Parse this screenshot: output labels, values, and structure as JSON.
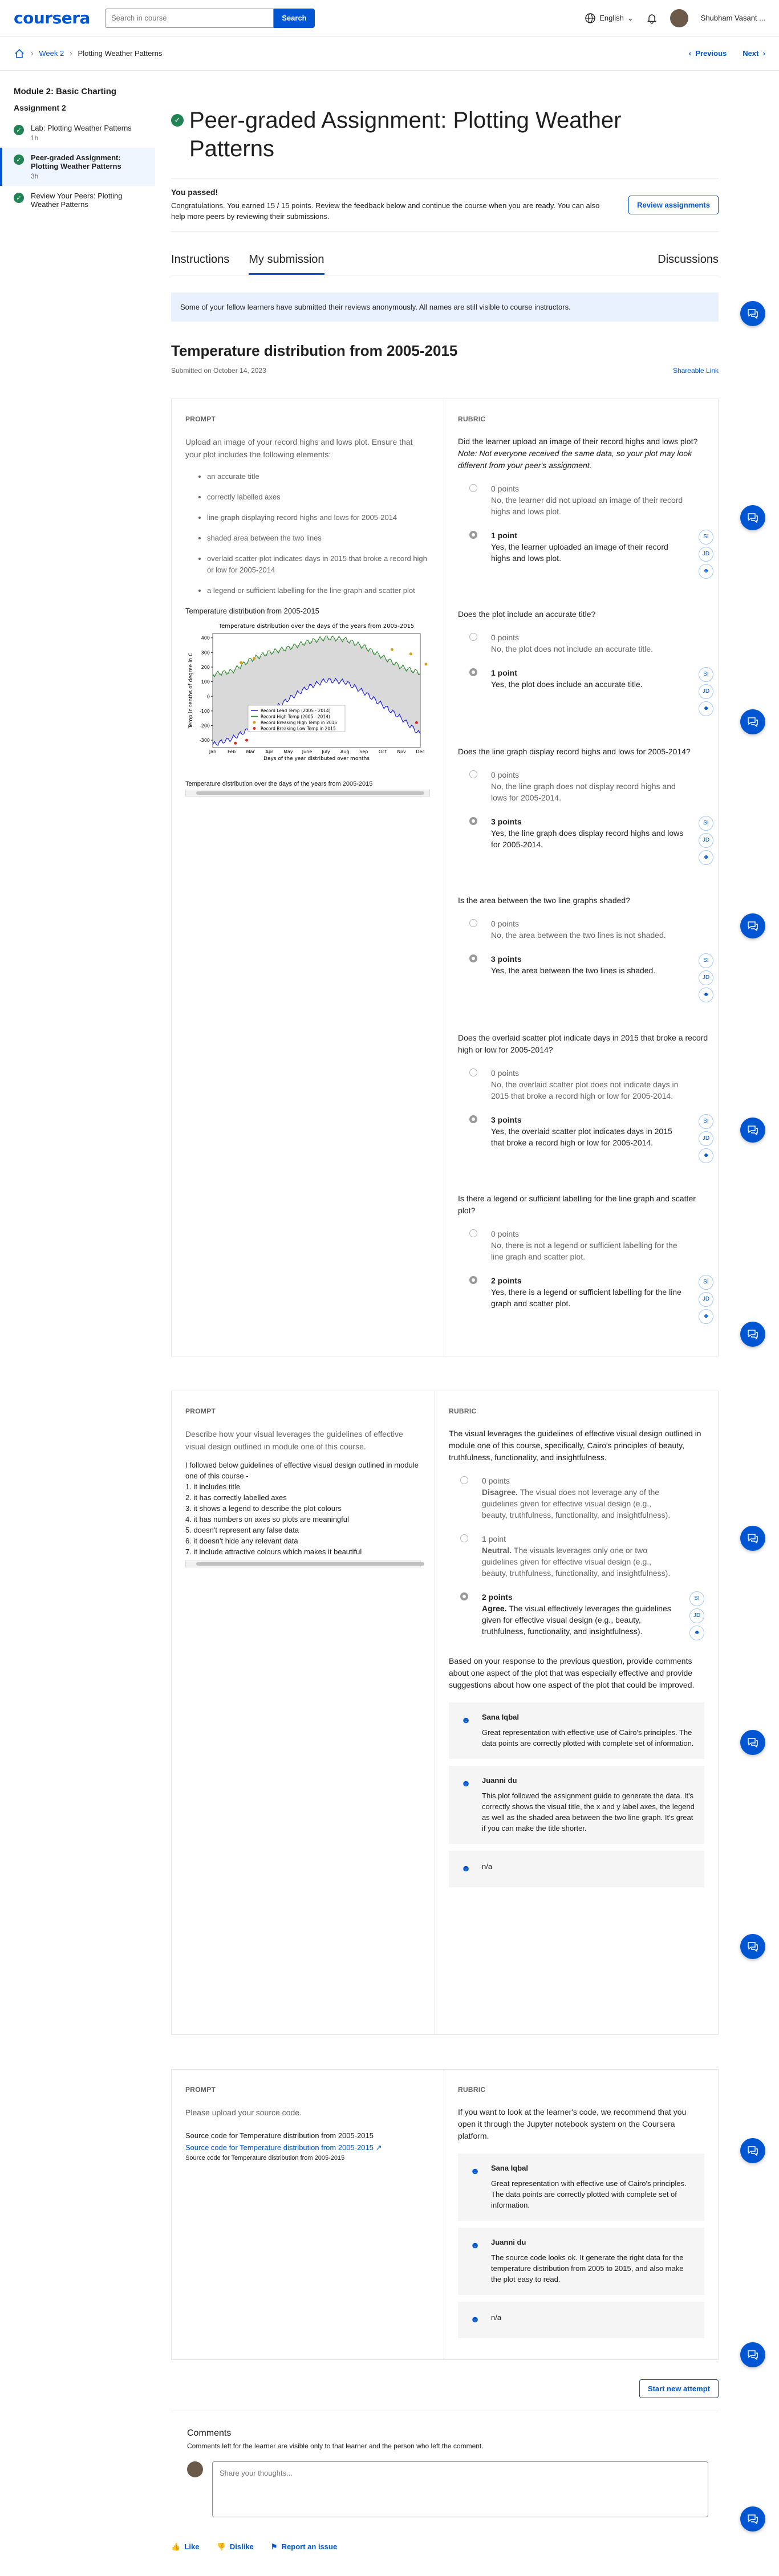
{
  "header": {
    "logo": "coursera",
    "search_placeholder": "Search in course",
    "search_button": "Search",
    "language": "English",
    "user_name": "Shubham Vasant ..."
  },
  "breadcrumb": {
    "week": "Week 2",
    "page": "Plotting Weather Patterns"
  },
  "nav": {
    "previous": "Previous",
    "next": "Next"
  },
  "sidebar": {
    "module": "Module 2: Basic Charting",
    "assignment": "Assignment 2",
    "items": [
      {
        "title": "Lab: Plotting Weather Patterns",
        "sub": "1h"
      },
      {
        "title": "Peer-graded Assignment: Plotting Weather Patterns",
        "sub": "3h"
      },
      {
        "title": "Review Your Peers: Plotting Weather Patterns",
        "sub": ""
      }
    ]
  },
  "main": {
    "title": "Peer-graded Assignment: Plotting Weather Patterns",
    "passed_title": "You passed!",
    "passed_text": "Congratulations. You earned 15 / 15 points. Review the feedback below and continue the course when you are ready. You can also help more peers by reviewing their submissions.",
    "review_button": "Review assignments",
    "tabs": [
      "Instructions",
      "My submission",
      "Discussions"
    ],
    "notice": "Some of your fellow learners have submitted their reviews anonymously. All names are still visible to course instructors.",
    "submission_title": "Temperature distribution from 2005-2015",
    "submitted_on": "Submitted on October 14, 2023",
    "shareable": "Shareable Link"
  },
  "labels": {
    "prompt": "PROMPT",
    "rubric": "RUBRIC"
  },
  "section1": {
    "prompt": "Upload an image of your record highs and lows plot. Ensure that your plot includes the following elements:",
    "bullets": [
      "an accurate title",
      "correctly labelled axes",
      "line graph displaying record highs and lows for 2005-2014",
      "shaded area between the two lines",
      "overlaid scatter plot indicates days in 2015 that broke a record high or low for 2005-2014",
      "a legend or sufficient labelling for the line graph and scatter plot"
    ],
    "response_title": "Temperature distribution from 2005-2015",
    "image_caption": "Temperature distribution over the days of the years from 2005-2015",
    "questions": [
      {
        "q": "Did the learner upload an image of their record highs and lows plot?",
        "note": "Note: Not everyone received the same data, so your plot may look different from your peer's assignment.",
        "opts": [
          {
            "pts": "0 points",
            "text": "No, the learner did not upload an image of their record highs and lows plot."
          },
          {
            "pts": "1 point",
            "text": "Yes, the learner uploaded an image of their record highs and lows plot."
          }
        ]
      },
      {
        "q": "Does the plot include an accurate title?",
        "opts": [
          {
            "pts": "0 points",
            "text": "No, the plot does not include an accurate title."
          },
          {
            "pts": "1 point",
            "text": "Yes, the plot does include an accurate title."
          }
        ]
      },
      {
        "q": "Does the line graph display record highs and lows for 2005-2014?",
        "opts": [
          {
            "pts": "0 points",
            "text": "No, the line graph does not display record highs and lows for 2005-2014."
          },
          {
            "pts": "3 points",
            "text": "Yes, the line graph does display record highs and lows for 2005-2014."
          }
        ]
      },
      {
        "q": "Is the area between the two line graphs shaded?",
        "opts": [
          {
            "pts": "0 points",
            "text": "No, the area between the two lines is not shaded."
          },
          {
            "pts": "3 points",
            "text": "Yes, the area between the two lines is shaded."
          }
        ]
      },
      {
        "q": "Does the overlaid scatter plot indicate days in 2015 that broke a record high or low for 2005-2014?",
        "opts": [
          {
            "pts": "0 points",
            "text": "No, the overlaid scatter plot does not indicate days in 2015 that broke a record high or low for 2005-2014."
          },
          {
            "pts": "3 points",
            "text": "Yes, the overlaid scatter plot indicates days in 2015 that broke a record high or low for 2005-2014."
          }
        ]
      },
      {
        "q": "Is there a legend or sufficient labelling for the line graph and scatter plot?",
        "opts": [
          {
            "pts": "0 points",
            "text": "No, there is not a legend or sufficient labelling for the line graph and scatter plot."
          },
          {
            "pts": "2 points",
            "text": "Yes, there is a legend or sufficient labelling for the line graph and scatter plot."
          }
        ]
      }
    ],
    "peer_initials": [
      "SI",
      "JD"
    ]
  },
  "chart_data": {
    "type": "line",
    "title": "Temperature distribution over the days of the years from 2005-2015",
    "xlabel": "Days of the year distributed over months",
    "ylabel": "Temp in tenths of degree in C",
    "categories": [
      "Jan",
      "Feb",
      "Mar",
      "Apr",
      "May",
      "June",
      "July",
      "Aug",
      "Sep",
      "Oct",
      "Nov",
      "Dec"
    ],
    "yticks": [
      -300,
      -200,
      -100,
      0,
      100,
      200,
      300,
      400
    ],
    "ylim": [
      -350,
      430
    ],
    "series": [
      {
        "name": "Record Lead Temp (2005 - 2014)",
        "color": "#1f1fd6",
        "values": [
          -330,
          -290,
          -220,
          -110,
          -20,
          60,
          110,
          100,
          30,
          -60,
          -150,
          -260
        ]
      },
      {
        "name": "Record High Temp (2005 - 2014)",
        "color": "#2e8b2e",
        "values": [
          150,
          170,
          250,
          300,
          330,
          370,
          400,
          390,
          340,
          270,
          200,
          160
        ]
      },
      {
        "name": "Record Breaking High Temp in 2015",
        "color": "#d4a017",
        "values": []
      },
      {
        "name": "Record Breaking Low Temp in 2015",
        "color": "#d62728",
        "values": []
      }
    ],
    "scatter_high_2015": [
      [
        1.5,
        230
      ],
      [
        2.2,
        260
      ],
      [
        9.5,
        320
      ],
      [
        10.5,
        290
      ],
      [
        11.3,
        220
      ]
    ],
    "scatter_low_2015": [
      [
        1.2,
        -320
      ],
      [
        1.8,
        -300
      ],
      [
        10.8,
        -180
      ]
    ]
  },
  "section2": {
    "prompt": "Describe how your visual leverages the guidelines of effective visual design outlined in module one of this course.",
    "response": [
      "I followed below guidelines of effective visual design outlined in module one of this course -",
      "1. it includes title",
      "2. it has correctly labelled axes",
      "3. it shows a legend to describe the plot colours",
      "4. it has numbers on axes so plots are meaningful",
      "5. doesn't represent any false data",
      "6. it doesn't hide any relevant data",
      "7. it include attractive colours which makes it beautiful"
    ],
    "rubric_q": "The visual leverages the guidelines of effective visual design outlined in module one of this course, specifically, Cairo's principles of beauty, truthfulness, functionality, and insightfulness.",
    "opts": [
      {
        "pts": "0 points",
        "head": "Disagree.",
        "text": "The visual does not leverage any of the guidelines given for effective visual design (e.g., beauty, truthfulness, functionality, and insightfulness)."
      },
      {
        "pts": "1 point",
        "head": "Neutral.",
        "text": "The visuals leverages only one or two guidelines given for effective visual design (e.g., beauty, truthfulness, functionality, and insightfulness)."
      },
      {
        "pts": "2 points",
        "head": "Agree.",
        "text": "The visual effectively leverages the guidelines given for effective visual design (e.g., beauty, truthfulness, functionality, and insightfulness)."
      }
    ],
    "followup": "Based on your response to the previous question, provide comments about one aspect of the plot that was especially effective and provide suggestions about how one aspect of the plot that could be improved.",
    "comments": [
      {
        "name": "Sana Iqbal",
        "text": "Great representation with effective use of Cairo's principles. The data points are correctly plotted with complete set of information."
      },
      {
        "name": "Juanni du",
        "text": "This plot followed the assignment guide to generate the data. It's correctly shows the visual title, the x and y label axes, the legend as well as the shaded area between the two line graph. It's great if you can make the title shorter."
      },
      {
        "name": "",
        "text": "n/a"
      }
    ]
  },
  "section3": {
    "prompt": "Please upload your source code.",
    "response_title": "Source code for Temperature distribution from 2005-2015",
    "link": "Source code for Temperature distribution from 2005-2015",
    "caption": "Source code for Temperature distribution from 2005-2015",
    "rubric_q": "If you want to look at the learner's code, we recommend that you open it through the Jupyter notebook system on the Coursera platform.",
    "comments": [
      {
        "name": "Sana Iqbal",
        "text": "Great representation with effective use of Cairo's principles. The data points are correctly plotted with complete set of information."
      },
      {
        "name": "Juanni du",
        "text": "The source code looks ok. It generate the right data for the temperature distribution from 2005 to 2015, and also make the plot easy to read."
      },
      {
        "name": "",
        "text": "n/a"
      }
    ]
  },
  "footer": {
    "new_attempt": "Start new attempt",
    "comments_title": "Comments",
    "comments_note": "Comments left for the learner are visible only to that learner and the person who left the comment.",
    "comment_placeholder": "Share your thoughts...",
    "like": "Like",
    "dislike": "Dislike",
    "report": "Report an issue"
  }
}
